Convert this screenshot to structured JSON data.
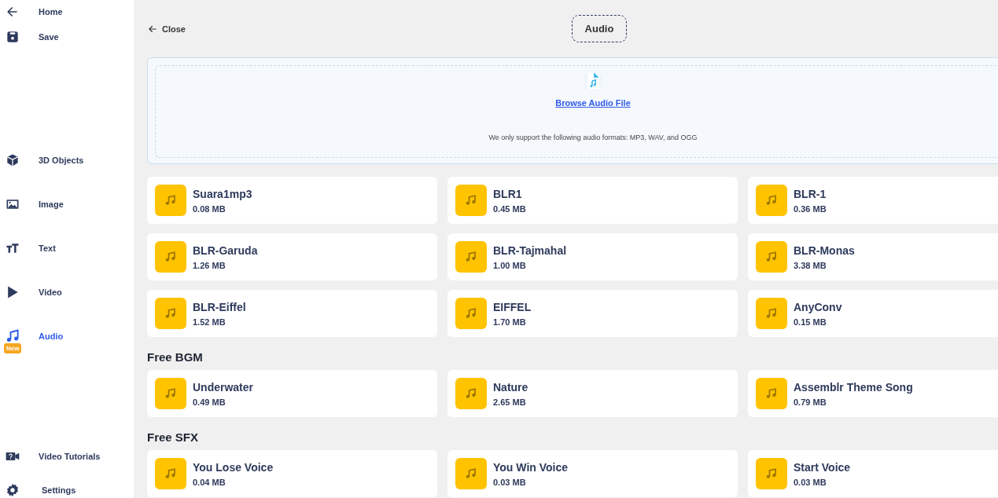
{
  "sidebar": {
    "top_items": [
      {
        "kind": "back",
        "label": "Home"
      },
      {
        "kind": "save",
        "label": "Save"
      }
    ],
    "tools": [
      {
        "kind": "cube",
        "label": "3D Objects",
        "selected": false
      },
      {
        "kind": "image",
        "label": "Image",
        "selected": false
      },
      {
        "kind": "text",
        "label": "Text",
        "selected": false
      },
      {
        "kind": "play",
        "label": "Video",
        "selected": false
      },
      {
        "kind": "music",
        "label": "Audio",
        "selected": true,
        "badge": "New"
      }
    ],
    "bottom_items": [
      {
        "kind": "tutorial",
        "label": "Video Tutorials"
      },
      {
        "kind": "gear",
        "label": "Settings"
      }
    ]
  },
  "header": {
    "close_label": "Close",
    "title": "Audio"
  },
  "upload": {
    "link": "Browse Audio File",
    "note": "We only support the following audio formats: MP3, WAV, and OGG"
  },
  "sections": [
    {
      "files": [
        {
          "name": "Suara1mp3",
          "size": "0.08 MB"
        },
        {
          "name": "BLR1",
          "size": "0.45 MB"
        },
        {
          "name": "BLR-1",
          "size": "0.36 MB"
        },
        {
          "name": "BLR-Garuda",
          "size": "1.26 MB"
        },
        {
          "name": "BLR-Tajmahal",
          "size": "1.00 MB"
        },
        {
          "name": "BLR-Monas",
          "size": "3.38 MB"
        },
        {
          "name": "BLR-Eiffel",
          "size": "1.52 MB"
        },
        {
          "name": "EIFFEL",
          "size": "1.70 MB"
        },
        {
          "name": "AnyConv",
          "size": "0.15 MB"
        }
      ]
    },
    {
      "title": "Free BGM",
      "files": [
        {
          "name": "Underwater",
          "size": "0.49 MB"
        },
        {
          "name": "Nature",
          "size": "2.65 MB"
        },
        {
          "name": "Assemblr Theme Song",
          "size": "0.79 MB"
        }
      ]
    },
    {
      "title": "Free SFX",
      "files": [
        {
          "name": "You Lose Voice",
          "size": "0.04 MB"
        },
        {
          "name": "You Win Voice",
          "size": "0.03 MB"
        },
        {
          "name": "Start Voice",
          "size": "0.03 MB"
        }
      ]
    }
  ]
}
